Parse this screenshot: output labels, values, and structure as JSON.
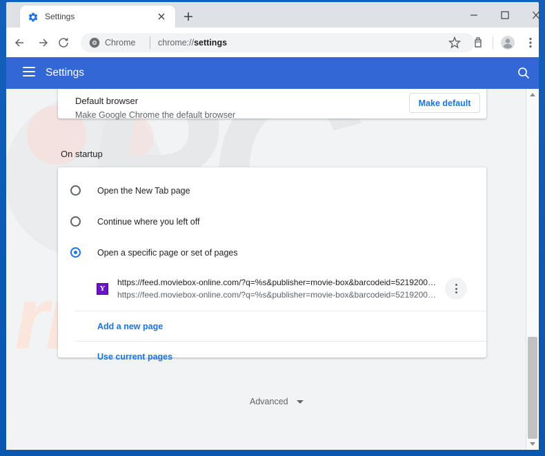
{
  "window": {
    "controls": {
      "minimize": "minimize",
      "maximize": "maximize",
      "close": "close"
    }
  },
  "tabstrip": {
    "tab_title": "Settings",
    "tab_icon": "settings-gear-icon",
    "close_icon": "close-icon",
    "new_tab_icon": "plus-icon"
  },
  "toolbar": {
    "back_icon": "back-arrow-icon",
    "forward_icon": "forward-arrow-icon",
    "reload_icon": "reload-icon",
    "chrome_badge_icon": "chrome-logo-icon",
    "chrome_badge_label": "Chrome",
    "url_prefix": "chrome://",
    "url_bold": "settings",
    "star_icon": "bookmark-star-icon",
    "extension_icon": "extension-icon",
    "profile_icon": "profile-avatar-icon",
    "menu_icon": "three-dot-menu-icon"
  },
  "settings_header": {
    "menu_icon": "hamburger-menu-icon",
    "title": "Settings",
    "search_icon": "search-icon",
    "background_color": "#3367d6"
  },
  "default_browser": {
    "title": "Default browser",
    "subtitle": "Make Google Chrome the default browser",
    "button_label": "Make default",
    "button_color": "#1a73e8"
  },
  "on_startup": {
    "heading": "On startup",
    "options": [
      {
        "label": "Open the New Tab page",
        "selected": false
      },
      {
        "label": "Continue where you left off",
        "selected": false
      },
      {
        "label": "Open a specific page or set of pages",
        "selected": true
      }
    ],
    "selected_color": "#1a73e8",
    "startup_page": {
      "favicon_letter": "Y",
      "favicon_color": "#6a14c4",
      "url": "https://feed.moviebox-online.com/?q=%s&publisher=movie-box&barcodeid=5219200…",
      "subtitle": "https://feed.moviebox-online.com/?q=%s&publisher=movie-box&barcodeid=5219200…",
      "menu_icon": "three-dot-menu-icon"
    },
    "links": [
      {
        "label": "Add a new page"
      },
      {
        "label": "Use current pages"
      }
    ]
  },
  "advanced": {
    "label": "Advanced",
    "chevron_icon": "chevron-down-icon"
  },
  "scrollbar": {
    "up_icon": "scroll-up-arrow-icon",
    "down_icon": "scroll-down-arrow-icon"
  },
  "watermarks": {
    "big": "PC",
    "small": "risk.com"
  }
}
